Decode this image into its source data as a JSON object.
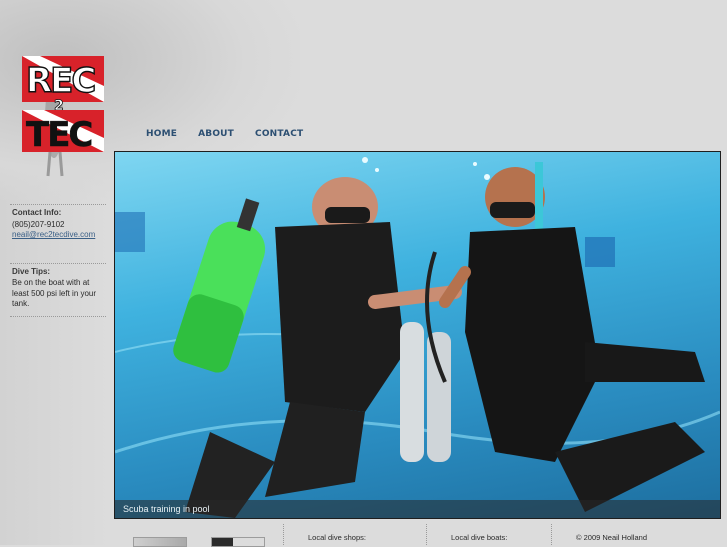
{
  "logo": {
    "line1": "REC",
    "line2": "2",
    "line3": "TEC"
  },
  "nav": {
    "items": [
      {
        "label": "Home"
      },
      {
        "label": "About"
      },
      {
        "label": "Contact"
      }
    ]
  },
  "sidebar": {
    "contact_title": "Contact Info:",
    "phone": "(805)207-9102",
    "email": "neail@rec2tecdive.com",
    "tips_title": "Dive Tips:",
    "tip_text": "Be on the boat with at least 500 psi left in your tank."
  },
  "hero": {
    "caption": "Scuba training in pool"
  },
  "footer": {
    "shops_label": "Local dive shops:",
    "boats_label": "Local dive boats:",
    "copyright": "© 2009 Neail Holland"
  },
  "colors": {
    "nav": "#2c4f72",
    "water": "#3fb2df",
    "logo_red": "#d8222a"
  }
}
